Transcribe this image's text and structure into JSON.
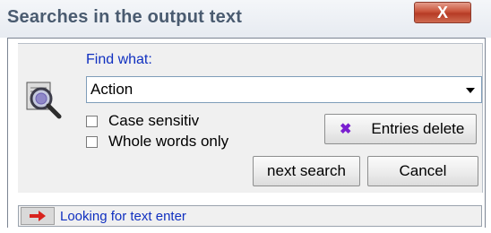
{
  "window": {
    "title": "Searches in the output text",
    "close_label": "X"
  },
  "find": {
    "label": "Find what:",
    "value": "Action"
  },
  "options": {
    "case_sensitive_label": "Case sensitiv",
    "whole_words_label": "Whole words only"
  },
  "buttons": {
    "entries_delete": "Entries delete",
    "next_search": "next search",
    "cancel": "Cancel"
  },
  "status": {
    "text": "Looking for text enter"
  },
  "colors": {
    "label_blue": "#1030c0",
    "delete_icon_purple": "#7a1fd0",
    "arrow_red": "#d8231e"
  },
  "icons": {
    "magnifier": "magnifier-icon",
    "delete": "delete-x-icon",
    "status_arrow": "right-arrow-icon"
  }
}
